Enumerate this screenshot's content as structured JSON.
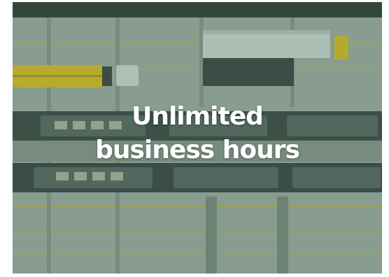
{
  "hero": {
    "headline_line1": "Unlimited",
    "headline_line2": "business hours",
    "image_subject": "aerial view of rail freight terminal with trains and trucks",
    "colors": {
      "overlay_tint": "#3c6e5a",
      "headline_text": "#ffffff",
      "train_yellow": "#e6c21f"
    }
  }
}
